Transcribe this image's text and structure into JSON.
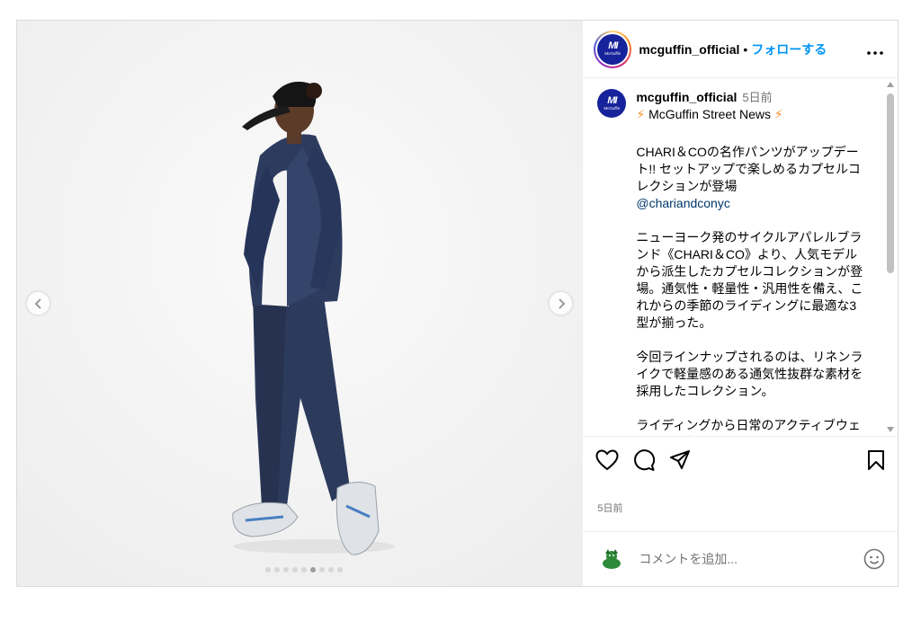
{
  "account": {
    "username": "mcguffin_official",
    "follow_label": "フォローする",
    "separator": "•",
    "logo_mark": "MI",
    "logo_word": "McGuffin"
  },
  "caption": {
    "username": "mcguffin_official",
    "time": "5日前",
    "news_line": "McGuffin Street News",
    "news_bolt": "⚡",
    "para1": "CHARI＆COの名作パンツがアップデート!! セットアップで楽しめるカプセルコレクションが登場",
    "mention": "@chariandconyc",
    "para2": "ニューヨーク発のサイクルアパレルブランド《CHARI＆CO》より、人気モデルから派生したカプセルコレクションが登場。通気性・軽量性・汎用性を備え、これからの季節のライディングに最適な3型が揃った。",
    "para3": "今回ラインナップされるのは、リネンライクで軽量感のある通気性抜群な素材を採用したコレクション。",
    "para4": "ライディングから日常のアクティブウェアまで、幅広いシーンで活躍するコ"
  },
  "post": {
    "date": "5日前",
    "carousel_total": 9,
    "carousel_active": 6
  },
  "comment": {
    "placeholder": "コメントを追加..."
  },
  "icons": {
    "more": "more-options-icon",
    "like": "heart-icon",
    "comment": "comment-icon",
    "share": "share-icon",
    "save": "bookmark-icon",
    "emoji": "emoji-icon",
    "prev": "chevron-left-icon",
    "next": "chevron-right-icon"
  },
  "colors": {
    "follow": "#0095f6",
    "brand": "#17239a",
    "bolt": "#f7902b",
    "mention": "#00376b"
  }
}
